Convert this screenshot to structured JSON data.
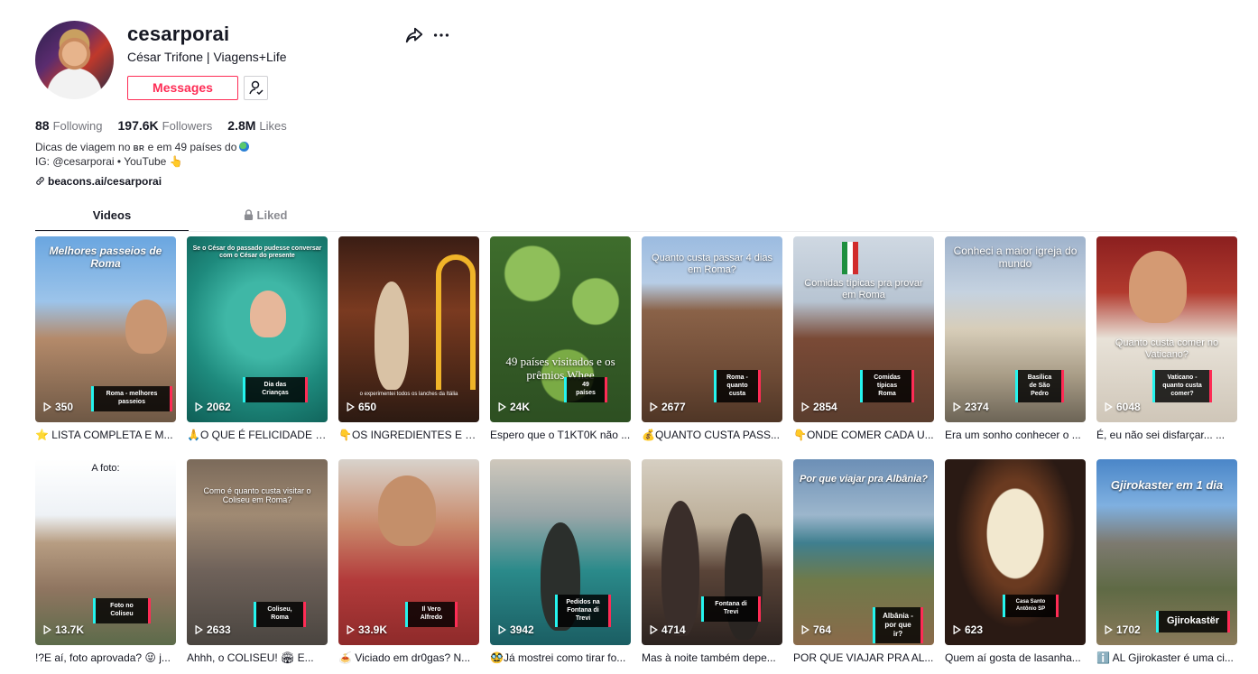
{
  "profile": {
    "username": "cesarporai",
    "nickname": "César Trifone | Viagens+Life",
    "message_label": "Messages",
    "stats": {
      "following_count": "88",
      "following_label": "Following",
      "followers_count": "197.6K",
      "followers_label": "Followers",
      "likes_count": "2.8M",
      "likes_label": "Likes"
    },
    "bio_line1_a": "Dicas de viagem no",
    "bio_line1_tag": "BR",
    "bio_line1_b": "e em 49 países do",
    "bio_line2": "IG: @cesarporai • YouTube 👆",
    "link": "beacons.ai/cesarporai"
  },
  "tabs": {
    "videos": "Videos",
    "liked": "Liked"
  },
  "colors": {
    "accent": "#fe2c55",
    "cyan": "#25f4ee",
    "text": "#161823",
    "muted": "#73747b"
  },
  "videos": [
    {
      "views": "350",
      "desc": "⭐ LISTA COMPLETA E M...",
      "overlay": "Melhores passeios de Roma",
      "caption": "Roma - melhores passeios"
    },
    {
      "views": "2062",
      "desc": "🙏O QUE É FELICIDADE P...",
      "overlay": "Se o César do passado pudesse conversar com o César do presente",
      "caption": "Dia das Crianças"
    },
    {
      "views": "650",
      "desc": "👇OS INGREDIENTES E DI...",
      "overlay": "",
      "caption": "o experimentei todos os lanches da Itália"
    },
    {
      "views": "24K",
      "desc": "Espero que o T1KT0K não ...",
      "overlay": "49 países visitados e os prêmios Whee",
      "caption": "49 países"
    },
    {
      "views": "2677",
      "desc": "💰QUANTO CUSTA PASS...",
      "overlay": "Quanto custa passar 4 dias em Roma?",
      "caption": "Roma - quanto custa"
    },
    {
      "views": "2854",
      "desc": "👇ONDE COMER CADA U...",
      "overlay": "Comidas típicas pra provar em Roma",
      "caption": "Comidas típicas Roma"
    },
    {
      "views": "2374",
      "desc": "Era um sonho conhecer o ...",
      "overlay": "Conheci a maior igreja do mundo",
      "caption": "Basílica de São Pedro"
    },
    {
      "views": "6048",
      "desc": "É, eu não sei disfarçar... ...",
      "overlay": "Quanto custa comer no Vaticano?",
      "caption": "Vaticano - quanto custa comer?"
    },
    {
      "views": "13.7K",
      "desc": "!?E aí, foto aprovada? 😜 j...",
      "overlay": "A foto:",
      "caption": "Foto no Coliseu"
    },
    {
      "views": "2633",
      "desc": "Ahhh, o COLISEU! 🏟 E...",
      "overlay": "Como é quanto custa visitar o Coliseu em Roma?",
      "caption": "Coliseu, Roma"
    },
    {
      "views": "33.9K",
      "desc": "🍝 Viciado em dr0gas? N...",
      "overlay": "",
      "caption": "Il Vero Alfredo"
    },
    {
      "views": "3942",
      "desc": "🥸Já mostrei como tirar fo...",
      "overlay": "",
      "caption": "Pedidos na Fontana di Trevi"
    },
    {
      "views": "4714",
      "desc": "Mas à noite também depe...",
      "overlay": "",
      "caption": "Fontana di Trevi"
    },
    {
      "views": "764",
      "desc": "POR QUE VIAJAR PRA AL...",
      "overlay": "Por que viajar pra Albânia?",
      "caption": "Albânia - por que ir?"
    },
    {
      "views": "623",
      "desc": "Quem aí gosta de lasanha...",
      "overlay": "",
      "caption": "Casa Santo Antônio SP"
    },
    {
      "views": "1702",
      "desc": "ℹ️ AL Gjirokaster é uma ci...",
      "overlay": "Gjirokaster em 1 dia",
      "caption": "Gjirokastër"
    }
  ]
}
